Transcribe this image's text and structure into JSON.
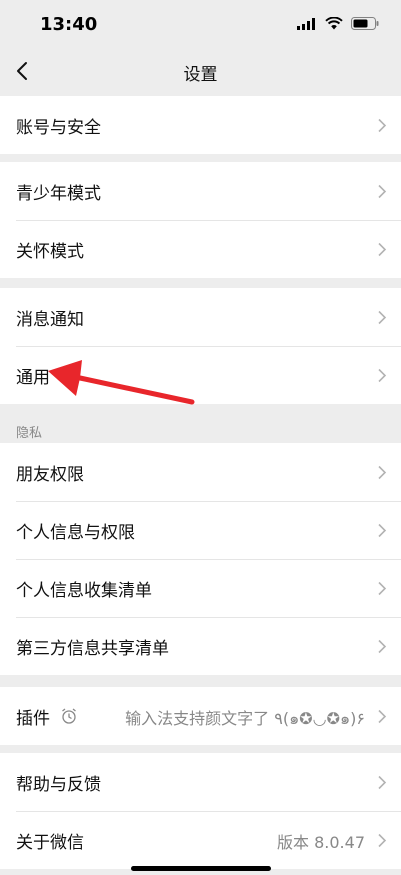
{
  "status_bar": {
    "time": "13:40",
    "icons": [
      "signal-icon",
      "wifi-icon",
      "battery-icon"
    ]
  },
  "nav": {
    "title": "设置",
    "back_icon": "chevron-left-icon"
  },
  "groups": [
    {
      "items": [
        {
          "label": "账号与安全"
        }
      ]
    },
    {
      "items": [
        {
          "label": "青少年模式"
        },
        {
          "label": "关怀模式"
        }
      ]
    },
    {
      "items": [
        {
          "label": "消息通知"
        },
        {
          "label": "通用"
        }
      ]
    },
    {
      "caption": "隐私",
      "items": [
        {
          "label": "朋友权限"
        },
        {
          "label": "个人信息与权限"
        },
        {
          "label": "个人信息收集清单"
        },
        {
          "label": "第三方信息共享清单"
        }
      ]
    },
    {
      "items": [
        {
          "label": "插件",
          "icon": "alarm-clock-icon",
          "value": "输入法支持颜文字了 ٩(๑✪◡✪๑)۶"
        }
      ]
    },
    {
      "items": [
        {
          "label": "帮助与反馈"
        },
        {
          "label": "关于微信",
          "value": "版本 8.0.47"
        }
      ]
    }
  ],
  "annotation": {
    "type": "red-arrow",
    "color": "#e8262b",
    "target": "通用"
  },
  "colors": {
    "background": "#ededed",
    "cell": "#ffffff",
    "divider": "#e5e5e5",
    "secondary_text": "#888888"
  }
}
